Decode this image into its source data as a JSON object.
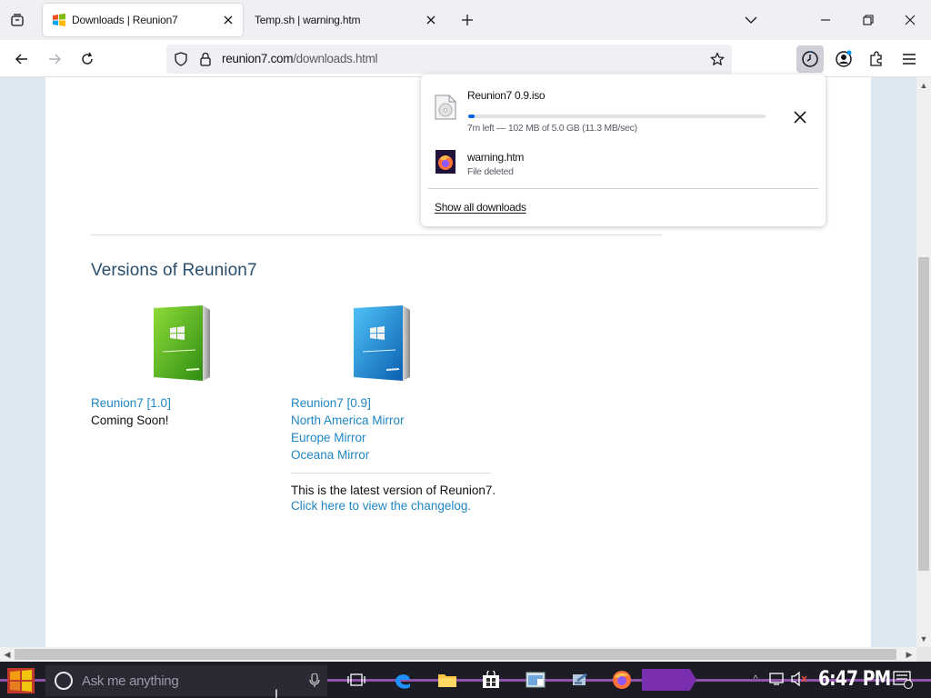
{
  "tabs": [
    {
      "title": "Downloads | Reunion7",
      "active": true
    },
    {
      "title": "Temp.sh | warning.htm",
      "active": false
    }
  ],
  "navbar": {
    "url_host": "reunion7.com",
    "url_path": "/downloads.html"
  },
  "page": {
    "section_title": "Versions of Reunion7",
    "version_a": {
      "name": "Reunion7 [1.0]",
      "status": "Coming Soon!"
    },
    "version_b": {
      "name": "Reunion7 [0.9]",
      "mirrors": [
        "North America Mirror",
        "Europe Mirror",
        "Oceana Mirror"
      ],
      "latest_note": "This is the latest version of Reunion7.",
      "changelog_link": "Click here to view the changelog."
    }
  },
  "downloads_panel": {
    "items": [
      {
        "name": "Reunion7 0.9.iso",
        "status": "7m left — 102 MB of 5.0 GB (11.3 MB/sec)",
        "progress": 0.02
      },
      {
        "name": "warning.htm",
        "status": "File deleted"
      }
    ],
    "show_all": "Show all downloads"
  },
  "taskbar": {
    "search_placeholder": "Ask me anything",
    "clock": "6:47 PM"
  },
  "colors": {
    "accent": "#0061e0",
    "link": "#1f86c2",
    "taskbar_accent": "#9b59b6"
  }
}
